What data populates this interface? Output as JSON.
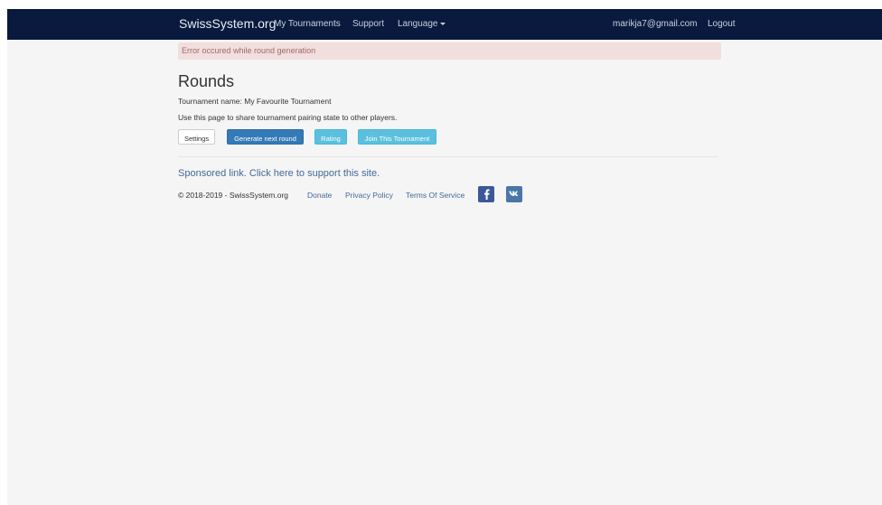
{
  "navbar": {
    "brand": "SwissSystem.org",
    "links": [
      "My Tournaments",
      "Support",
      "Language"
    ],
    "user_email": "marikja7@gmail.com",
    "logout": "Logout"
  },
  "alert": {
    "message": "Error occured while round generation"
  },
  "main": {
    "title": "Rounds",
    "tournament_name": "Tournament name: My Favourite Tournament",
    "description": "Use this page to share tournament pairing state to other players.",
    "buttons": {
      "settings": "Settings",
      "generate": "Generate next round",
      "rating": "Rating",
      "join": "Join This Tournament"
    }
  },
  "footer": {
    "sponsored": "Sponsored link. Click here to support this site.",
    "copyright": "© 2018-2019 - SwissSystem.org",
    "links": [
      "Donate",
      "Privacy Policy",
      "Terms Of Service"
    ],
    "social_icons": [
      "facebook-icon",
      "vk-icon"
    ]
  },
  "colors": {
    "navbar_bg": "#091a3e",
    "alert_bg": "#f2dede",
    "primary": "#337ab7",
    "info": "#5bc0de",
    "link": "#3f6b96"
  }
}
